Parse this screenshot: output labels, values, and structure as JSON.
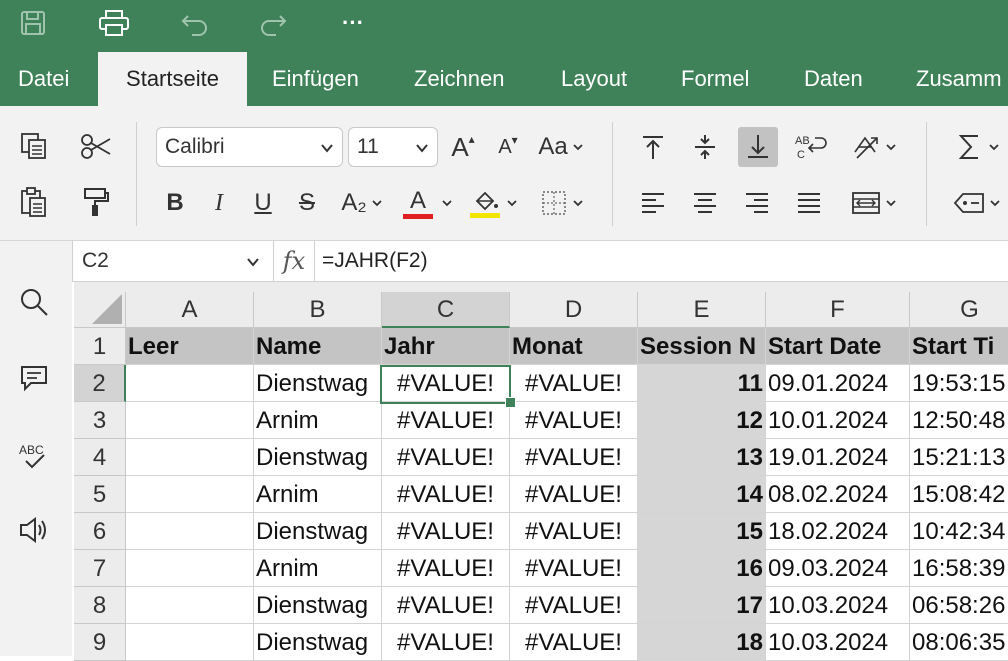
{
  "quick_access": {
    "save_icon": "save-icon",
    "print_icon": "print-icon",
    "undo_icon": "undo-icon",
    "redo_icon": "redo-icon",
    "more_label": "···"
  },
  "tabs": [
    {
      "label": "Datei"
    },
    {
      "label": "Startseite"
    },
    {
      "label": "Einfügen"
    },
    {
      "label": "Zeichnen"
    },
    {
      "label": "Layout"
    },
    {
      "label": "Formel"
    },
    {
      "label": "Daten"
    },
    {
      "label": "Zusamm"
    }
  ],
  "active_tab": "Startseite",
  "ribbon": {
    "font_name": "Calibri",
    "font_size": "11",
    "bold": "B",
    "italic": "I",
    "underline": "U",
    "strike": "S",
    "subscript": "A₂",
    "font_color_letter": "A",
    "grow_font": "A",
    "shrink_font": "A",
    "change_case": "Aa",
    "font_color": "#e02020",
    "highlight_color": "#f2e600"
  },
  "formula_bar": {
    "name_box": "C2",
    "fx_label": "fx",
    "formula": "=JAHR(F2)"
  },
  "grid": {
    "columns": [
      "A",
      "B",
      "C",
      "D",
      "E",
      "F",
      "G"
    ],
    "selected_column": "C",
    "selected_row": "2",
    "rows": [
      {
        "num": "1",
        "cells": [
          "Leer",
          "Name",
          "Jahr",
          "Monat",
          "Session N",
          "Start Date",
          "Start Ti"
        ]
      },
      {
        "num": "2",
        "cells": [
          "",
          "Dienstwag",
          "#VALUE!",
          "#VALUE!",
          "11",
          "09.01.2024",
          "19:53:15"
        ]
      },
      {
        "num": "3",
        "cells": [
          "",
          "Arnim",
          "#VALUE!",
          "#VALUE!",
          "12",
          "10.01.2024",
          "12:50:48"
        ]
      },
      {
        "num": "4",
        "cells": [
          "",
          "Dienstwag",
          "#VALUE!",
          "#VALUE!",
          "13",
          "19.01.2024",
          "15:21:13"
        ]
      },
      {
        "num": "5",
        "cells": [
          "",
          "Arnim",
          "#VALUE!",
          "#VALUE!",
          "14",
          "08.02.2024",
          "15:08:42"
        ]
      },
      {
        "num": "6",
        "cells": [
          "",
          "Dienstwag",
          "#VALUE!",
          "#VALUE!",
          "15",
          "18.02.2024",
          "10:42:34"
        ]
      },
      {
        "num": "7",
        "cells": [
          "",
          "Arnim",
          "#VALUE!",
          "#VALUE!",
          "16",
          "09.03.2024",
          "16:58:39"
        ]
      },
      {
        "num": "8",
        "cells": [
          "",
          "Dienstwag",
          "#VALUE!",
          "#VALUE!",
          "17",
          "10.03.2024",
          "06:58:26"
        ]
      },
      {
        "num": "9",
        "cells": [
          "",
          "Dienstwag",
          "#VALUE!",
          "#VALUE!",
          "18",
          "10.03.2024",
          "08:06:35"
        ]
      }
    ]
  },
  "colors": {
    "accent": "#3f8158",
    "ribbon_bg": "#f2f2f2",
    "header_row_bg": "#c4c4c4",
    "session_col_bg": "#d6d6d6"
  }
}
